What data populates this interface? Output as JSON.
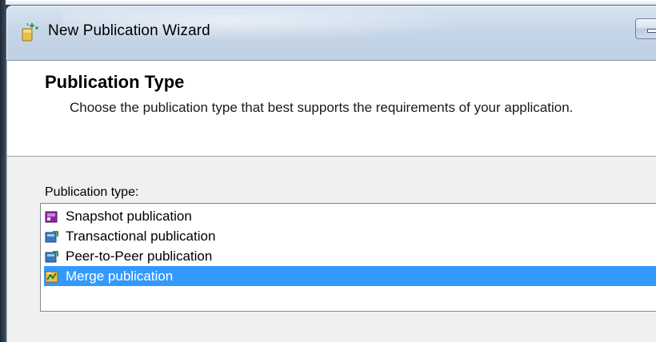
{
  "window": {
    "title": "New Publication Wizard",
    "icon": "publication-wizard-icon"
  },
  "header": {
    "title": "Publication Type",
    "description": "Choose the publication type that best supports the requirements of your application."
  },
  "form": {
    "publication_type_label": "Publication type:",
    "selected_index": 3,
    "items": [
      {
        "label": "Snapshot publication",
        "icon": "snapshot-publication-icon"
      },
      {
        "label": "Transactional publication",
        "icon": "transactional-publication-icon"
      },
      {
        "label": "Peer-to-Peer publication",
        "icon": "peer-to-peer-publication-icon"
      },
      {
        "label": "Merge publication",
        "icon": "merge-publication-icon"
      }
    ]
  },
  "colors": {
    "selection": "#3399ff",
    "header_background": "#ffffff",
    "body_background": "#f0f0f0"
  }
}
